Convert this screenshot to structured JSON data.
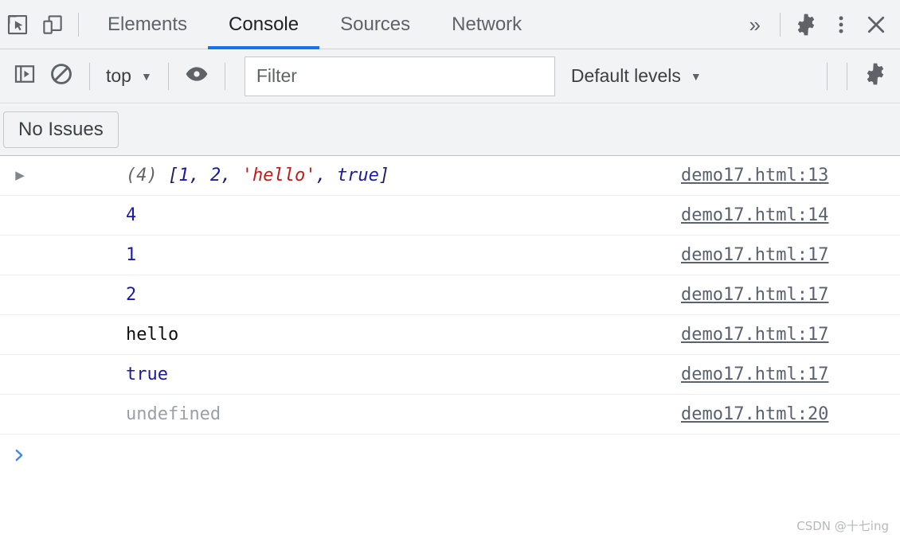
{
  "theme": {
    "toolbar_bg": "#f1f3f4",
    "panel_bg": "#ffffff",
    "accent_blue": "#1a73e8",
    "prompt_blue": "#4285f4",
    "number_color": "#1a1aa6",
    "string_color": "#c41a16",
    "undefined_color": "#9aa0a6",
    "link_color": "#5a6270",
    "divider_color": "#eceff1"
  },
  "tabbar": {
    "inspect_icon": "inspect-element-icon",
    "device_icon": "device-toolbar-icon",
    "tabs": [
      {
        "label": "Elements",
        "active": false
      },
      {
        "label": "Console",
        "active": true
      },
      {
        "label": "Sources",
        "active": false
      },
      {
        "label": "Network",
        "active": false
      }
    ],
    "more_tabs_icon": "chevron-double-right-icon",
    "more_tabs_glyph": "»",
    "settings_icon": "gear-icon",
    "more_options_icon": "vertical-dots-icon",
    "close_icon": "close-icon"
  },
  "console_toolbar": {
    "sidebar_toggle_icon": "console-sidebar-toggle-icon",
    "clear_icon": "clear-console-icon",
    "context": {
      "label": "top",
      "caret": "▼"
    },
    "eye_icon": "live-expression-eye-icon",
    "filter": {
      "value": "",
      "placeholder": "Filter"
    },
    "levels": {
      "label": "Default levels",
      "caret": "▼"
    },
    "settings_icon": "console-settings-gear-icon"
  },
  "issues_bar": {
    "button_label": "No Issues"
  },
  "console_messages": [
    {
      "kind": "array",
      "expandable": true,
      "disclosure_glyph": "▶",
      "count_label": "(4)",
      "open_bracket": "[",
      "close_bracket": "]",
      "items": [
        {
          "text": "1",
          "type": "number"
        },
        {
          "text": "2",
          "type": "number"
        },
        {
          "text": "'hello'",
          "type": "string"
        },
        {
          "text": "true",
          "type": "boolean"
        }
      ],
      "separator": ", ",
      "source": "demo17.html:13"
    },
    {
      "kind": "value",
      "expandable": false,
      "text": "4",
      "type": "number",
      "source": "demo17.html:14"
    },
    {
      "kind": "value",
      "expandable": false,
      "text": "1",
      "type": "number",
      "source": "demo17.html:17"
    },
    {
      "kind": "value",
      "expandable": false,
      "text": "2",
      "type": "number",
      "source": "demo17.html:17"
    },
    {
      "kind": "value",
      "expandable": false,
      "text": "hello",
      "type": "plain",
      "source": "demo17.html:17"
    },
    {
      "kind": "value",
      "expandable": false,
      "text": "true",
      "type": "boolean",
      "source": "demo17.html:17"
    },
    {
      "kind": "value",
      "expandable": false,
      "text": "undefined",
      "type": "undefined",
      "source": "demo17.html:20"
    }
  ],
  "prompt": {
    "caret_icon": "chevron-right-prompt-icon",
    "value": ""
  },
  "watermark": {
    "text": "CSDN @十七ing"
  }
}
